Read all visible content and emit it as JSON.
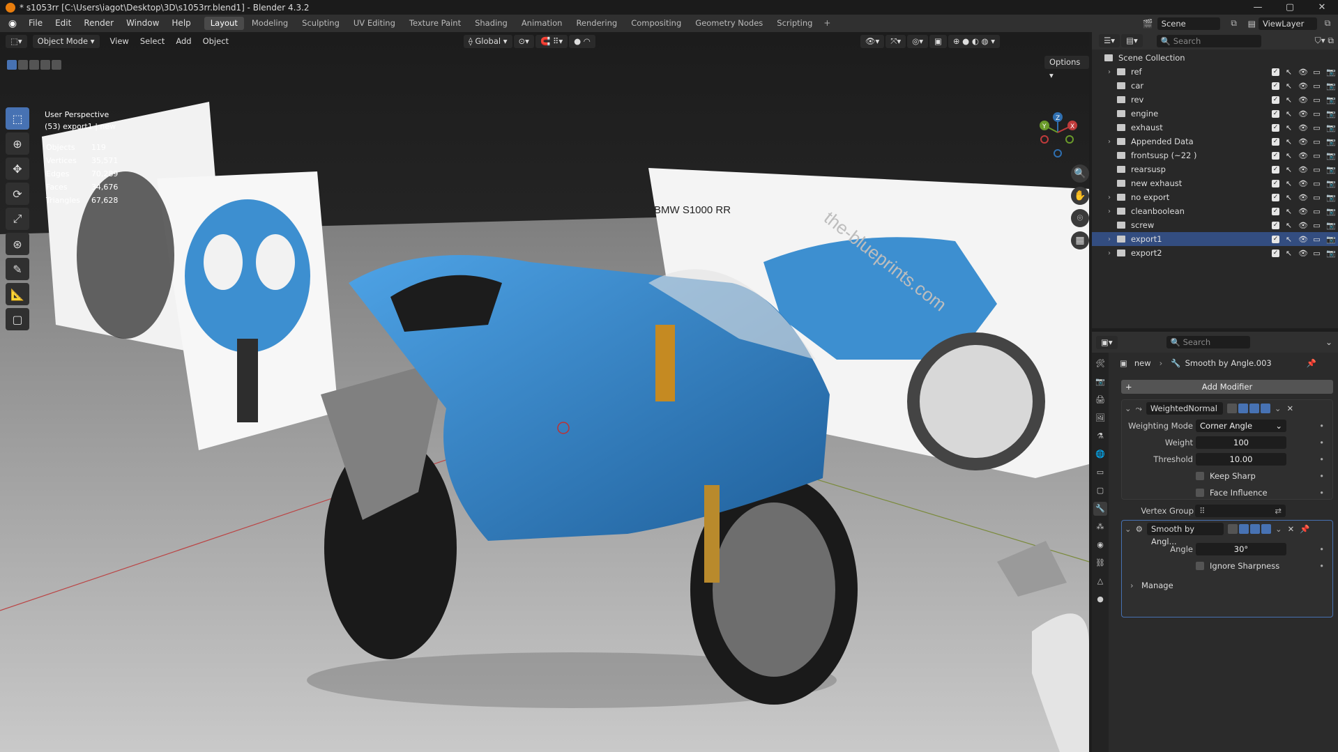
{
  "window": {
    "title": "* s1053rr [C:\\Users\\iagot\\Desktop\\3D\\s1053rr.blend1] - Blender 4.3.2",
    "controls": [
      "—",
      "▢",
      "✕"
    ]
  },
  "menu": {
    "items": [
      "File",
      "Edit",
      "Render",
      "Window",
      "Help"
    ],
    "workspaces": [
      "Layout",
      "Modeling",
      "Sculpting",
      "UV Editing",
      "Texture Paint",
      "Shading",
      "Animation",
      "Rendering",
      "Compositing",
      "Geometry Nodes",
      "Scripting"
    ],
    "active_workspace": "Layout",
    "scene": "Scene",
    "view_layer": "ViewLayer"
  },
  "viewport": {
    "mode": "Object Mode",
    "menus": [
      "View",
      "Select",
      "Add",
      "Object"
    ],
    "orientation": "Global",
    "options_label": "Options",
    "perspective": "User Perspective",
    "active_info": "(53) export1 | new",
    "stats": [
      {
        "label": "Objects",
        "value": "119"
      },
      {
        "label": "Vertices",
        "value": "35,571"
      },
      {
        "label": "Edges",
        "value": "70,289"
      },
      {
        "label": "Faces",
        "value": "34,676"
      },
      {
        "label": "Triangles",
        "value": "67,628"
      }
    ],
    "gizmo_axes": [
      "Z",
      "Y",
      "X"
    ],
    "blueprint_title": "BMW S1000 RR",
    "watermark": "the-blueprints.com",
    "colors": {
      "bike_blue": "#2f7fc4",
      "floor": "#b8b8b8",
      "sky": "#222222",
      "accent": "#4772b3"
    }
  },
  "outliner": {
    "search_placeholder": "Search",
    "root": "Scene Collection",
    "items": [
      {
        "name": "ref",
        "expandable": true,
        "selected": false
      },
      {
        "name": "car",
        "expandable": false,
        "selected": false
      },
      {
        "name": "rev",
        "expandable": false,
        "selected": false
      },
      {
        "name": "engine",
        "expandable": false,
        "selected": false
      },
      {
        "name": "exhaust",
        "expandable": false,
        "selected": false
      },
      {
        "name": "Appended Data",
        "expandable": true,
        "selected": false
      },
      {
        "name": "frontsusp (~22 )",
        "expandable": false,
        "selected": false
      },
      {
        "name": "rearsusp",
        "expandable": false,
        "selected": false
      },
      {
        "name": "new exhaust",
        "expandable": false,
        "selected": false
      },
      {
        "name": "no export",
        "expandable": true,
        "selected": false
      },
      {
        "name": "cleanboolean",
        "expandable": true,
        "selected": false
      },
      {
        "name": "screw",
        "expandable": false,
        "selected": false
      },
      {
        "name": "export1",
        "expandable": true,
        "selected": true
      },
      {
        "name": "export2",
        "expandable": true,
        "selected": false
      }
    ]
  },
  "properties": {
    "search_placeholder": "Search",
    "breadcrumb_object": "new",
    "breadcrumb_modifier": "Smooth by Angle.003",
    "add_modifier": "Add Modifier",
    "weighted_normal": {
      "name": "WeightedNormal",
      "weighting_mode_label": "Weighting Mode",
      "weighting_mode": "Corner Angle",
      "weight_label": "Weight",
      "weight": "100",
      "threshold_label": "Threshold",
      "threshold": "10.00",
      "keep_sharp": "Keep Sharp",
      "face_influence": "Face Influence",
      "vertex_group_label": "Vertex Group"
    },
    "smooth_by_angle": {
      "name": "Smooth by Angl...",
      "angle_label": "Angle",
      "angle": "30°",
      "ignore_sharpness": "Ignore Sharpness",
      "manage": "Manage"
    }
  }
}
